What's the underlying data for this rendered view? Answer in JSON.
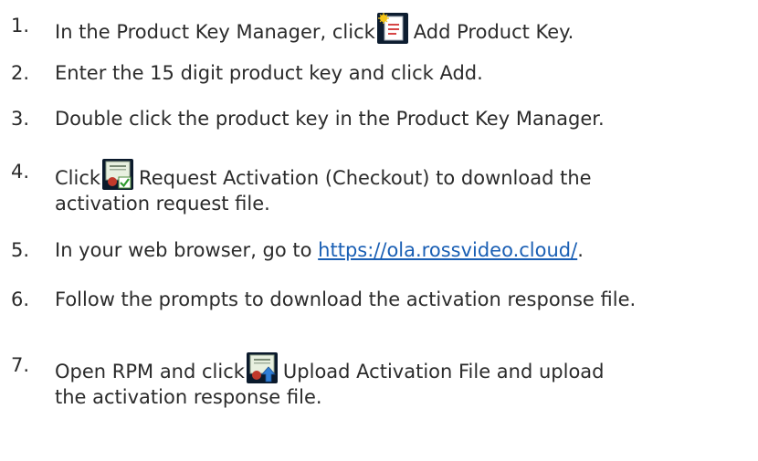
{
  "steps": [
    {
      "number": "1.",
      "before": "In the Product Key Manager, click",
      "icon": "add-product-key-icon",
      "after": "Add Product Key."
    },
    {
      "number": "2.",
      "text": "Enter the 15 digit product key and click Add."
    },
    {
      "number": "3.",
      "text": "Double click the product key in the Product Key Manager."
    },
    {
      "number": "4.",
      "before": "Click",
      "icon": "request-activation-icon",
      "after": "Request Activation (Checkout) to download the",
      "continuation": "activation request file."
    },
    {
      "number": "5.",
      "before": "In your web browser, go to",
      "link": "https://ola.rossvideo.cloud/",
      "after": "."
    },
    {
      "number": "6.",
      "text": "Follow the prompts to download the activation response file."
    },
    {
      "number": "7.",
      "before": "Open RPM and click",
      "icon": "upload-activation-file-icon",
      "after": "Upload Activation File and upload",
      "continuation": "the activation response file."
    }
  ],
  "colors": {
    "text": "#2b2b2b",
    "link": "#1a5fb4",
    "icon_bg": "#0b1a2c"
  }
}
